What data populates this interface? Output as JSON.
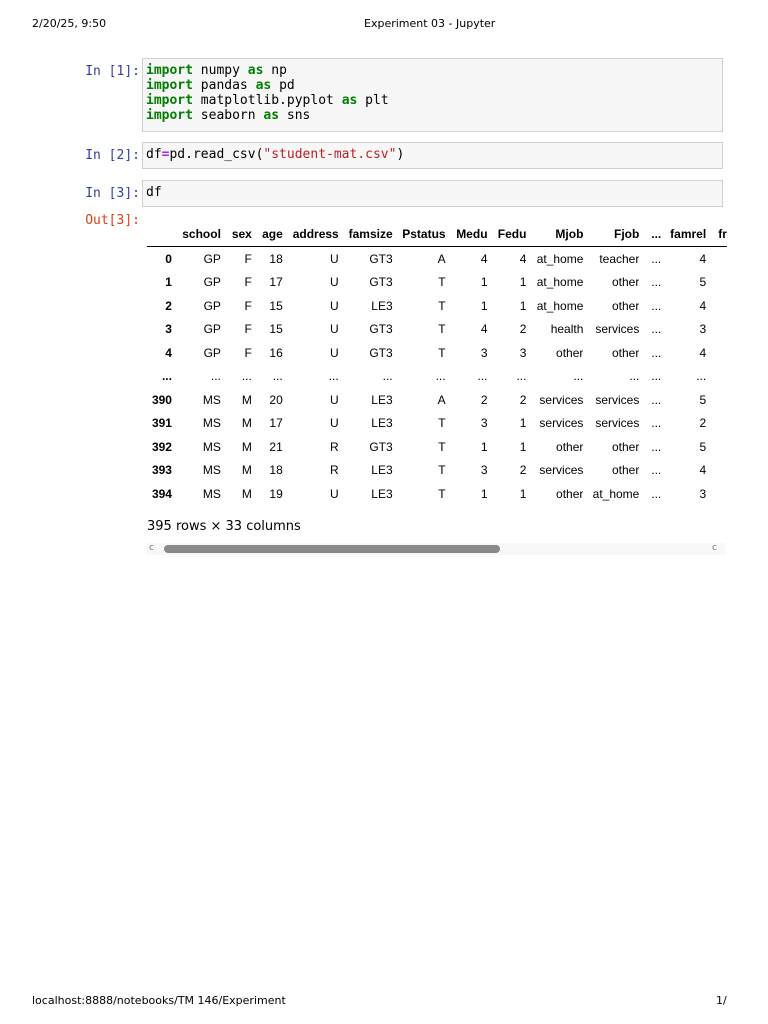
{
  "header": {
    "datetime": "2/20/25, 9:50",
    "title": "Experiment 03 - Jupyter"
  },
  "footer": {
    "url": "localhost:8888/notebooks/TM 146/Experiment",
    "page": "1/"
  },
  "cells": [
    {
      "prompt": "In [1]:"
    },
    {
      "prompt": "In [2]:"
    },
    {
      "prompt": "In [3]:",
      "code": "df"
    }
  ],
  "code": {
    "import": "import",
    "as": "as",
    "l1a": " numpy ",
    "l1b": " np",
    "l2a": " pandas ",
    "l2b": " pd",
    "l3a": " matplotlib.pyplot ",
    "l3b": " plt",
    "l4a": " seaborn ",
    "l4b": " sns",
    "c2a": "df",
    "c2eq": "=",
    "c2b": "pd.read_csv(",
    "c2s": "\"student-mat.csv\"",
    "c2c": ")"
  },
  "output": {
    "prompt": "Out[3]:",
    "columns": [
      "",
      "school",
      "sex",
      "age",
      "address",
      "famsize",
      "Pstatus",
      "Medu",
      "Fedu",
      "Mjob",
      "Fjob",
      "...",
      "famrel",
      "fr"
    ],
    "rows": [
      [
        "0",
        "GP",
        "F",
        "18",
        "U",
        "GT3",
        "A",
        "4",
        "4",
        "at_home",
        "teacher",
        "...",
        "4",
        ""
      ],
      [
        "1",
        "GP",
        "F",
        "17",
        "U",
        "GT3",
        "T",
        "1",
        "1",
        "at_home",
        "other",
        "...",
        "5",
        ""
      ],
      [
        "2",
        "GP",
        "F",
        "15",
        "U",
        "LE3",
        "T",
        "1",
        "1",
        "at_home",
        "other",
        "...",
        "4",
        ""
      ],
      [
        "3",
        "GP",
        "F",
        "15",
        "U",
        "GT3",
        "T",
        "4",
        "2",
        "health",
        "services",
        "...",
        "3",
        ""
      ],
      [
        "4",
        "GP",
        "F",
        "16",
        "U",
        "GT3",
        "T",
        "3",
        "3",
        "other",
        "other",
        "...",
        "4",
        ""
      ],
      [
        "...",
        "...",
        "...",
        "...",
        "...",
        "...",
        "...",
        "...",
        "...",
        "...",
        "...",
        "...",
        "...",
        ""
      ],
      [
        "390",
        "MS",
        "M",
        "20",
        "U",
        "LE3",
        "A",
        "2",
        "2",
        "services",
        "services",
        "...",
        "5",
        ""
      ],
      [
        "391",
        "MS",
        "M",
        "17",
        "U",
        "LE3",
        "T",
        "3",
        "1",
        "services",
        "services",
        "...",
        "2",
        ""
      ],
      [
        "392",
        "MS",
        "M",
        "21",
        "R",
        "GT3",
        "T",
        "1",
        "1",
        "other",
        "other",
        "...",
        "5",
        ""
      ],
      [
        "393",
        "MS",
        "M",
        "18",
        "R",
        "LE3",
        "T",
        "3",
        "2",
        "services",
        "other",
        "...",
        "4",
        ""
      ],
      [
        "394",
        "MS",
        "M",
        "19",
        "U",
        "LE3",
        "T",
        "1",
        "1",
        "other",
        "at_home",
        "...",
        "3",
        ""
      ]
    ],
    "summary": "395 rows × 33 columns",
    "scroll_left": "c",
    "scroll_right": "c"
  }
}
